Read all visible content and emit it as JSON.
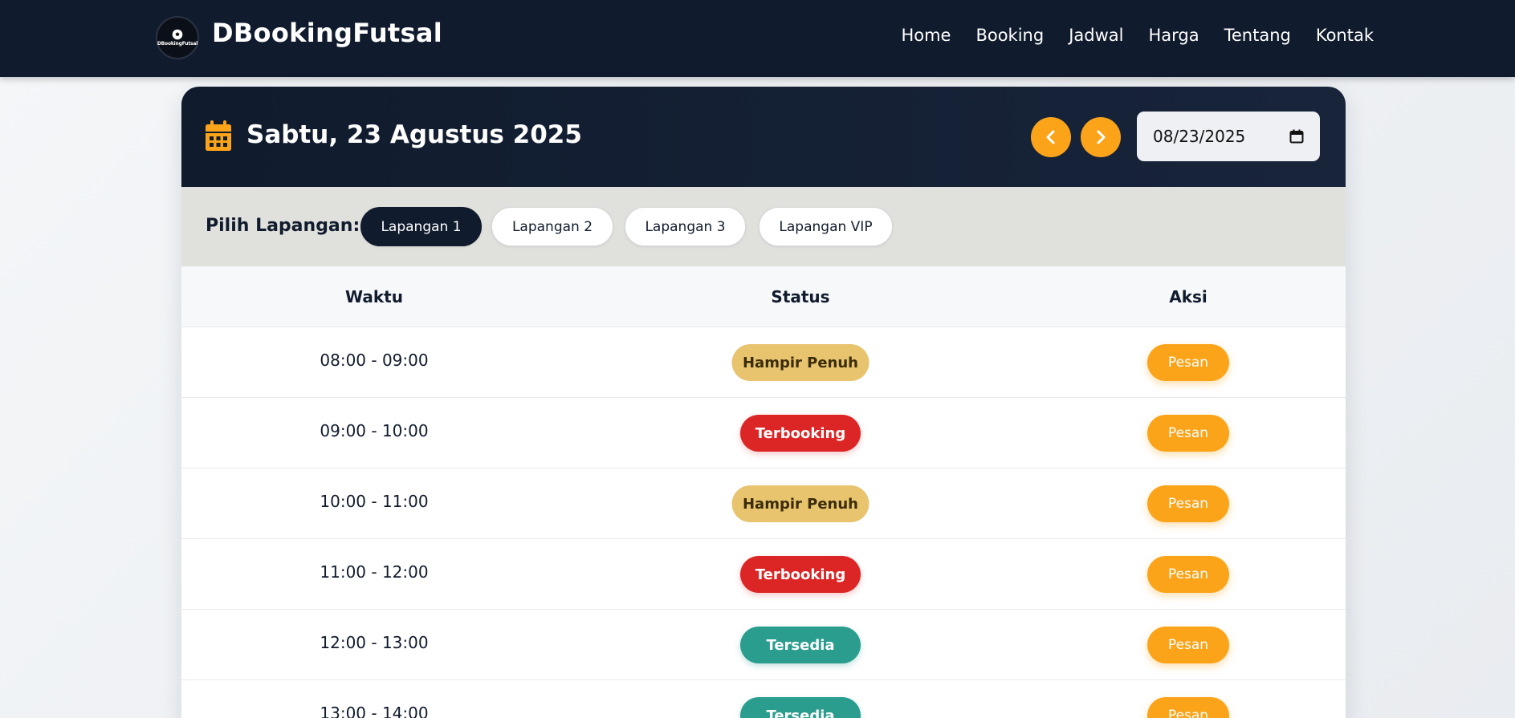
{
  "navbar": {
    "logo_text": "DBookingFutsal",
    "brand": "DBookingFutsal",
    "links": [
      "Home",
      "Booking",
      "Jadwal",
      "Harga",
      "Tentang",
      "Kontak"
    ]
  },
  "schedule": {
    "date_title": "Sabtu, 23 Agustus 2025",
    "date_input_value": "08/23/2025",
    "field_label": "Pilih Lapangan:",
    "fields": [
      "Lapangan 1",
      "Lapangan 2",
      "Lapangan 3",
      "Lapangan VIP"
    ],
    "active_field": "Lapangan 1"
  },
  "table": {
    "headers": [
      "Waktu",
      "Status",
      "Aksi"
    ],
    "rows": [
      {
        "time": "08:00 - 09:00",
        "status": "Hampir Penuh",
        "action": "Pesan"
      },
      {
        "time": "09:00 - 10:00",
        "status": "Terbooking",
        "action": "Pesan"
      },
      {
        "time": "10:00 - 11:00",
        "status": "Hampir Penuh",
        "action": "Pesan"
      },
      {
        "time": "11:00 - 12:00",
        "status": "Terbooking",
        "action": "Pesan"
      },
      {
        "time": "12:00 - 13:00",
        "status": "Tersedia",
        "action": "Pesan"
      },
      {
        "time": "13:00 - 14:00",
        "status": "Tersedia",
        "action": "Pesan"
      }
    ]
  },
  "colors": {
    "navbar": "#101b2d",
    "accent": "#fba41a",
    "status_hampir_penuh": "#e8c46e",
    "status_terbooking": "#dc2626",
    "status_tersedia": "#2a9d8f"
  },
  "icons": {
    "logo": "soccer-ball-icon",
    "date": "calendar-icon",
    "prev": "chevron-left-icon",
    "next": "chevron-right-icon",
    "date_picker": "calendar-picker-icon"
  }
}
